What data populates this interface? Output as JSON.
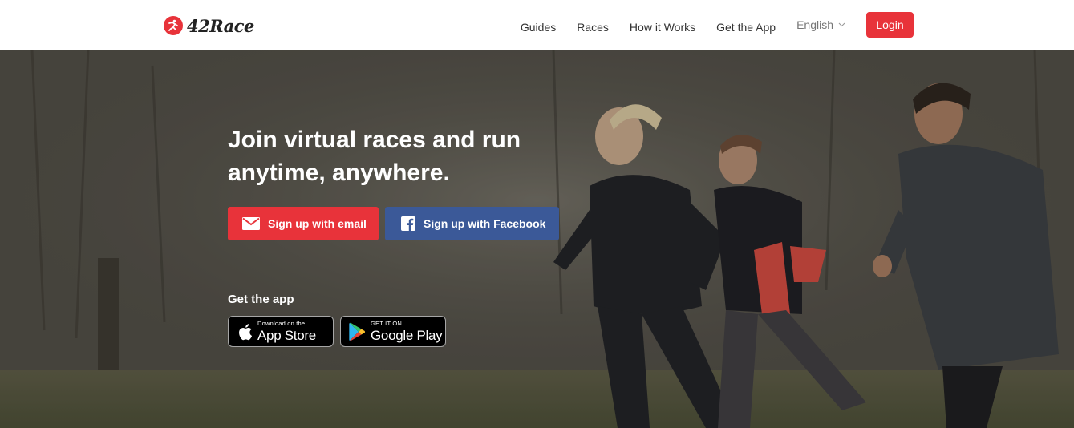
{
  "brand": {
    "name": "42Race"
  },
  "nav": {
    "links": [
      "Guides",
      "Races",
      "How it Works",
      "Get the App"
    ],
    "language": "English",
    "login_label": "Login"
  },
  "hero": {
    "headline_line1": "Join virtual races and run",
    "headline_line2": "anytime, anywhere.",
    "email_button": "Sign up with email",
    "facebook_button": "Sign up with Facebook",
    "get_app_label": "Get the app",
    "app_store": {
      "small": "Download on the",
      "big": "App Store"
    },
    "google_play": {
      "small": "GET IT ON",
      "big": "Google Play"
    }
  },
  "colors": {
    "accent": "#e8333a",
    "facebook": "#3b5998"
  }
}
